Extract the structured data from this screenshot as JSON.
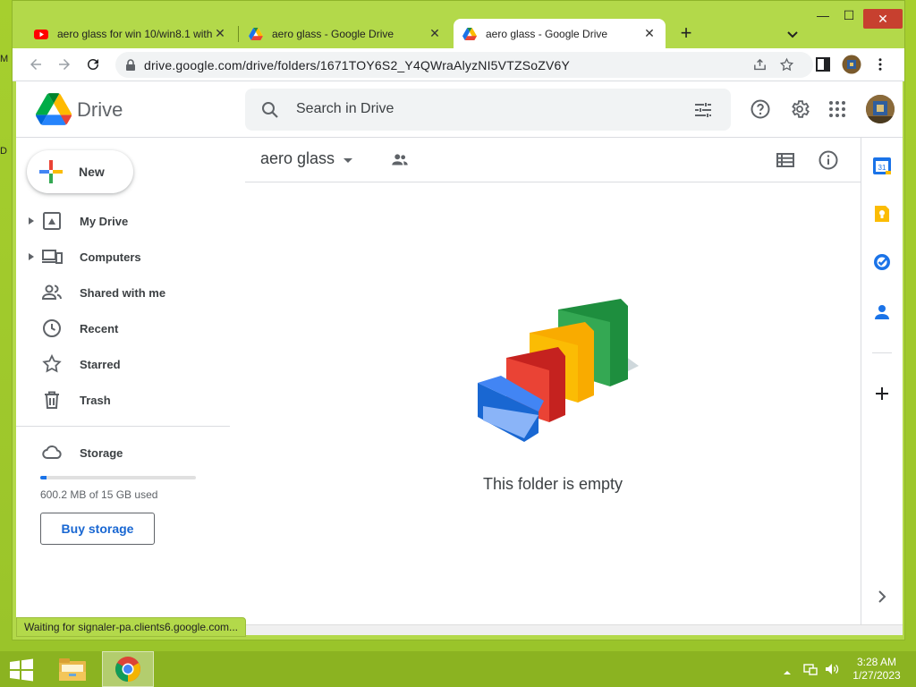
{
  "desktop": {
    "left_letters": [
      "M",
      "D"
    ]
  },
  "browser": {
    "tabs": [
      {
        "title": "aero glass for win 10/win8.1 with",
        "favicon": "youtube-icon",
        "active": false
      },
      {
        "title": "aero glass - Google Drive",
        "favicon": "drive-icon",
        "active": false
      },
      {
        "title": "aero glass - Google Drive",
        "favicon": "drive-icon",
        "active": true
      }
    ],
    "close_glyph": "✕",
    "new_tab_glyph": "+",
    "window_controls": {
      "minimize": "—",
      "maximize": "☐",
      "close": "✕"
    },
    "url": "drive.google.com/drive/folders/1671TOY6S2_Y4QWraAlyzNI5VTZSoZV6Y"
  },
  "drive": {
    "product_name": "Drive",
    "search_placeholder": "Search in Drive",
    "new_button": "New",
    "nav": [
      {
        "label": "My Drive",
        "icon": "my-drive-icon",
        "expandable": true
      },
      {
        "label": "Computers",
        "icon": "computers-icon",
        "expandable": true
      },
      {
        "label": "Shared with me",
        "icon": "shared-with-me-icon",
        "expandable": false
      },
      {
        "label": "Recent",
        "icon": "clock-icon",
        "expandable": false
      },
      {
        "label": "Starred",
        "icon": "star-icon",
        "expandable": false
      },
      {
        "label": "Trash",
        "icon": "trash-icon",
        "expandable": false
      }
    ],
    "storage": {
      "label": "Storage",
      "used_text": "600.2 MB of 15 GB used",
      "used_fraction": 0.04,
      "buy_button": "Buy storage"
    },
    "folder_title": "aero glass",
    "empty_message": "This folder is empty",
    "colors": {
      "accent": "#1a73e8",
      "text": "#3c4043",
      "green": "#1e8e3e",
      "yellow": "#fbbc04",
      "red": "#d93025",
      "blue": "#4285f4"
    }
  },
  "status_text": "Waiting for signaler-pa.clients6.google.com...",
  "taskbar": {
    "time": "3:28 AM",
    "date": "1/27/2023"
  }
}
